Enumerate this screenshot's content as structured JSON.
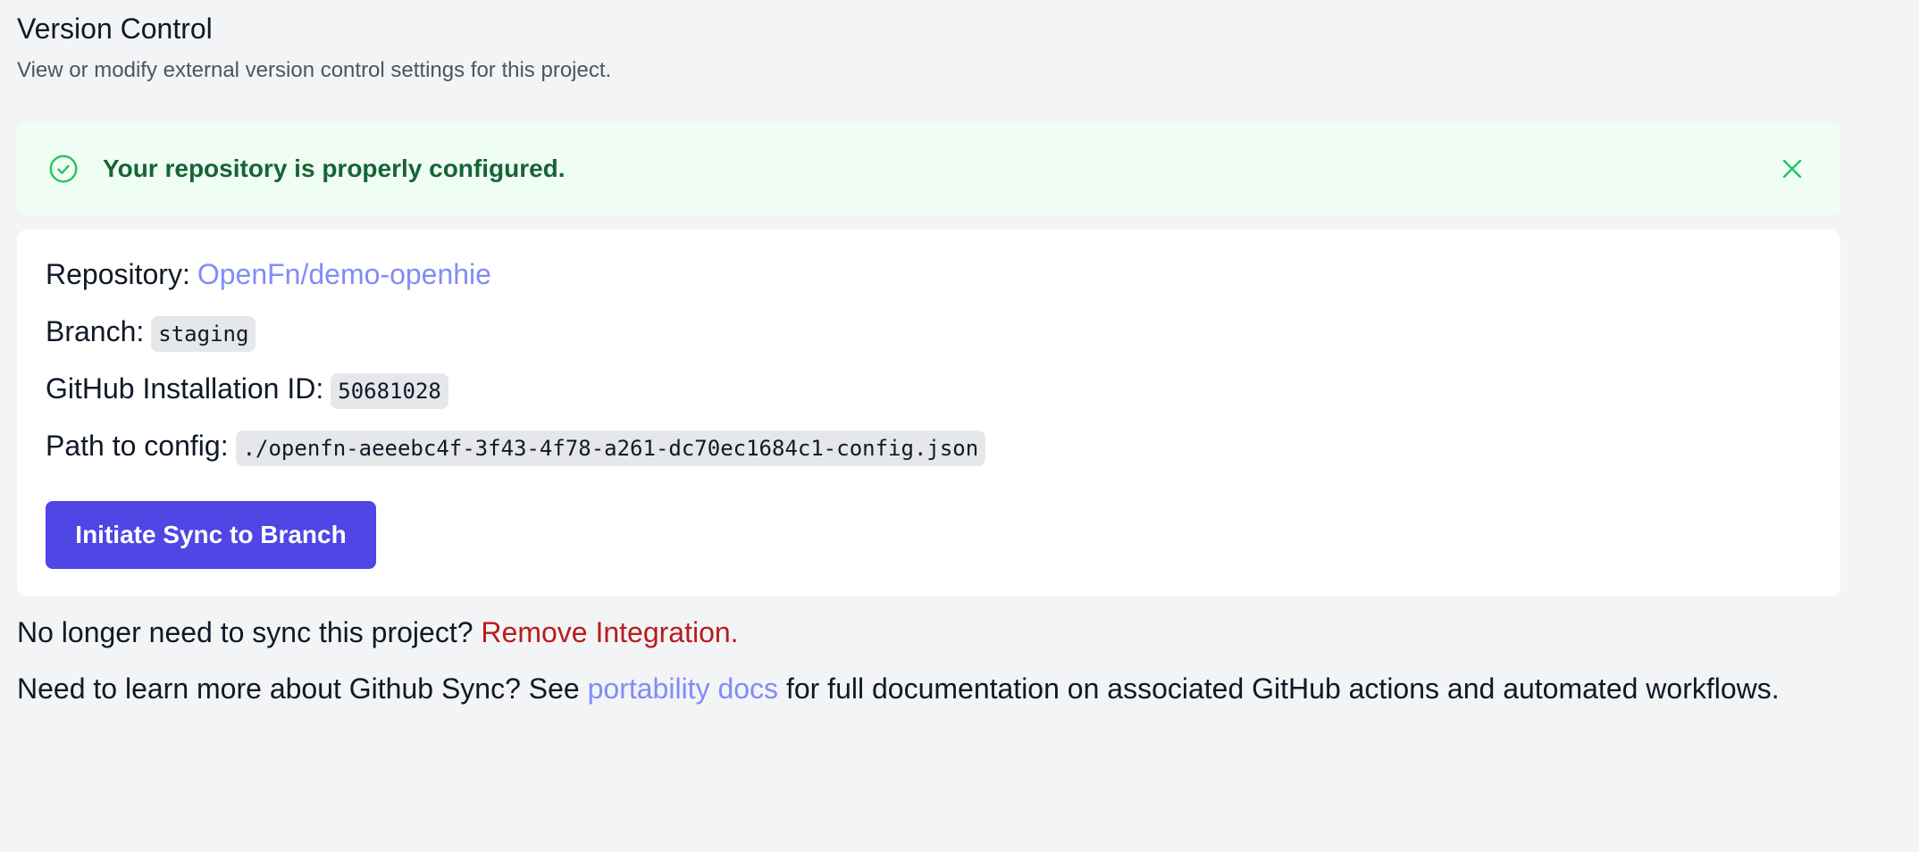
{
  "header": {
    "title": "Version Control",
    "subtitle": "View or modify external version control settings for this project."
  },
  "alert": {
    "message": "Your repository is properly configured.",
    "icon": "check-circle-icon",
    "close_icon": "close-icon",
    "color": "#166534",
    "background": "#f0fdf4"
  },
  "details": {
    "repository_label": "Repository:",
    "repository_value": "OpenFn/demo-openhie",
    "branch_label": "Branch:",
    "branch_value": "staging",
    "installation_label": "GitHub Installation ID:",
    "installation_value": "50681028",
    "path_label": "Path to config:",
    "path_value": "./openfn-aeeebc4f-3f43-4f78-a261-dc70ec1684c1-config.json"
  },
  "actions": {
    "sync_button": "Initiate Sync to Branch",
    "button_color": "#4f46e5"
  },
  "footer": {
    "remove_prompt": "No longer need to sync this project?",
    "remove_link": "Remove Integration.",
    "docs_prefix": "Need to learn more about Github Sync? See",
    "docs_link": "portability docs",
    "docs_suffix": "for full documentation on associated GitHub actions and automated workflows.",
    "link_color": "#818cf8",
    "danger_color": "#b91c1c"
  }
}
